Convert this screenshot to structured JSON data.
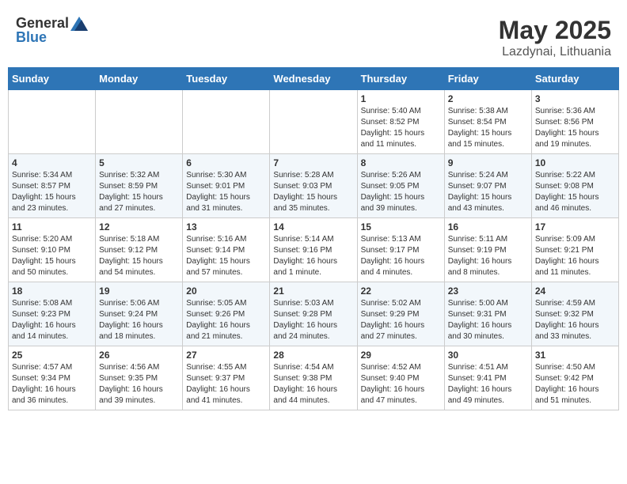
{
  "header": {
    "logo_general": "General",
    "logo_blue": "Blue",
    "month": "May 2025",
    "location": "Lazdynai, Lithuania"
  },
  "weekdays": [
    "Sunday",
    "Monday",
    "Tuesday",
    "Wednesday",
    "Thursday",
    "Friday",
    "Saturday"
  ],
  "weeks": [
    [
      {
        "day": "",
        "info": ""
      },
      {
        "day": "",
        "info": ""
      },
      {
        "day": "",
        "info": ""
      },
      {
        "day": "",
        "info": ""
      },
      {
        "day": "1",
        "info": "Sunrise: 5:40 AM\nSunset: 8:52 PM\nDaylight: 15 hours\nand 11 minutes."
      },
      {
        "day": "2",
        "info": "Sunrise: 5:38 AM\nSunset: 8:54 PM\nDaylight: 15 hours\nand 15 minutes."
      },
      {
        "day": "3",
        "info": "Sunrise: 5:36 AM\nSunset: 8:56 PM\nDaylight: 15 hours\nand 19 minutes."
      }
    ],
    [
      {
        "day": "4",
        "info": "Sunrise: 5:34 AM\nSunset: 8:57 PM\nDaylight: 15 hours\nand 23 minutes."
      },
      {
        "day": "5",
        "info": "Sunrise: 5:32 AM\nSunset: 8:59 PM\nDaylight: 15 hours\nand 27 minutes."
      },
      {
        "day": "6",
        "info": "Sunrise: 5:30 AM\nSunset: 9:01 PM\nDaylight: 15 hours\nand 31 minutes."
      },
      {
        "day": "7",
        "info": "Sunrise: 5:28 AM\nSunset: 9:03 PM\nDaylight: 15 hours\nand 35 minutes."
      },
      {
        "day": "8",
        "info": "Sunrise: 5:26 AM\nSunset: 9:05 PM\nDaylight: 15 hours\nand 39 minutes."
      },
      {
        "day": "9",
        "info": "Sunrise: 5:24 AM\nSunset: 9:07 PM\nDaylight: 15 hours\nand 43 minutes."
      },
      {
        "day": "10",
        "info": "Sunrise: 5:22 AM\nSunset: 9:08 PM\nDaylight: 15 hours\nand 46 minutes."
      }
    ],
    [
      {
        "day": "11",
        "info": "Sunrise: 5:20 AM\nSunset: 9:10 PM\nDaylight: 15 hours\nand 50 minutes."
      },
      {
        "day": "12",
        "info": "Sunrise: 5:18 AM\nSunset: 9:12 PM\nDaylight: 15 hours\nand 54 minutes."
      },
      {
        "day": "13",
        "info": "Sunrise: 5:16 AM\nSunset: 9:14 PM\nDaylight: 15 hours\nand 57 minutes."
      },
      {
        "day": "14",
        "info": "Sunrise: 5:14 AM\nSunset: 9:16 PM\nDaylight: 16 hours\nand 1 minute."
      },
      {
        "day": "15",
        "info": "Sunrise: 5:13 AM\nSunset: 9:17 PM\nDaylight: 16 hours\nand 4 minutes."
      },
      {
        "day": "16",
        "info": "Sunrise: 5:11 AM\nSunset: 9:19 PM\nDaylight: 16 hours\nand 8 minutes."
      },
      {
        "day": "17",
        "info": "Sunrise: 5:09 AM\nSunset: 9:21 PM\nDaylight: 16 hours\nand 11 minutes."
      }
    ],
    [
      {
        "day": "18",
        "info": "Sunrise: 5:08 AM\nSunset: 9:23 PM\nDaylight: 16 hours\nand 14 minutes."
      },
      {
        "day": "19",
        "info": "Sunrise: 5:06 AM\nSunset: 9:24 PM\nDaylight: 16 hours\nand 18 minutes."
      },
      {
        "day": "20",
        "info": "Sunrise: 5:05 AM\nSunset: 9:26 PM\nDaylight: 16 hours\nand 21 minutes."
      },
      {
        "day": "21",
        "info": "Sunrise: 5:03 AM\nSunset: 9:28 PM\nDaylight: 16 hours\nand 24 minutes."
      },
      {
        "day": "22",
        "info": "Sunrise: 5:02 AM\nSunset: 9:29 PM\nDaylight: 16 hours\nand 27 minutes."
      },
      {
        "day": "23",
        "info": "Sunrise: 5:00 AM\nSunset: 9:31 PM\nDaylight: 16 hours\nand 30 minutes."
      },
      {
        "day": "24",
        "info": "Sunrise: 4:59 AM\nSunset: 9:32 PM\nDaylight: 16 hours\nand 33 minutes."
      }
    ],
    [
      {
        "day": "25",
        "info": "Sunrise: 4:57 AM\nSunset: 9:34 PM\nDaylight: 16 hours\nand 36 minutes."
      },
      {
        "day": "26",
        "info": "Sunrise: 4:56 AM\nSunset: 9:35 PM\nDaylight: 16 hours\nand 39 minutes."
      },
      {
        "day": "27",
        "info": "Sunrise: 4:55 AM\nSunset: 9:37 PM\nDaylight: 16 hours\nand 41 minutes."
      },
      {
        "day": "28",
        "info": "Sunrise: 4:54 AM\nSunset: 9:38 PM\nDaylight: 16 hours\nand 44 minutes."
      },
      {
        "day": "29",
        "info": "Sunrise: 4:52 AM\nSunset: 9:40 PM\nDaylight: 16 hours\nand 47 minutes."
      },
      {
        "day": "30",
        "info": "Sunrise: 4:51 AM\nSunset: 9:41 PM\nDaylight: 16 hours\nand 49 minutes."
      },
      {
        "day": "31",
        "info": "Sunrise: 4:50 AM\nSunset: 9:42 PM\nDaylight: 16 hours\nand 51 minutes."
      }
    ]
  ]
}
